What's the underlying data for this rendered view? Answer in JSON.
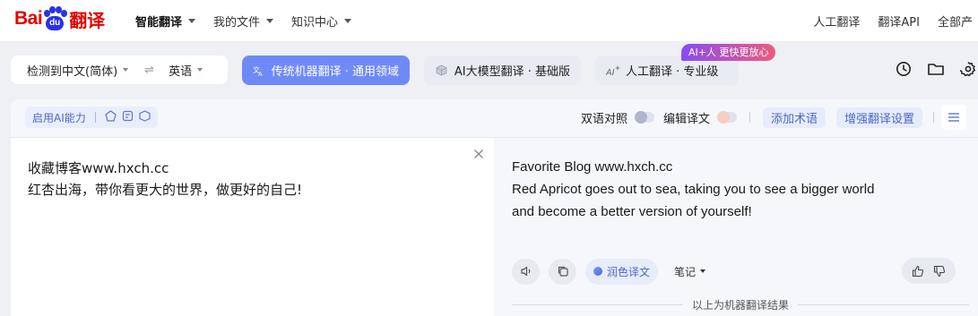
{
  "header": {
    "logo_text_bai": "Bai",
    "logo_text_du": "du",
    "logo_text_fanyi": "翻译",
    "nav": [
      {
        "label": "智能翻译",
        "active": true
      },
      {
        "label": "我的文件",
        "active": false
      },
      {
        "label": "知识中心",
        "active": false
      }
    ],
    "right_links": [
      "人工翻译",
      "翻译API",
      "全部产"
    ]
  },
  "lang": {
    "source": "检测到中文(简体)",
    "swap": "⇌",
    "target": "英语"
  },
  "modes": [
    {
      "label": "传统机器翻译 · 通用领域",
      "active": true,
      "icon": "translate-icon"
    },
    {
      "label": "AI大模型翻译 · 基础版",
      "active": false,
      "icon": "cube-icon"
    },
    {
      "label": "人工翻译 · 专业级",
      "active": false,
      "icon": "ai-sparkle-icon"
    }
  ],
  "promo": "AI+人 更快更放心",
  "toolbar": {
    "ai_label": "启用AI能力",
    "bilingual": "双语对照",
    "edit": "编辑译文",
    "add_term": "添加术语",
    "enhance": "增强翻译设置"
  },
  "source_text": "收藏博客www.hxch.cc\n红杏出海，带你看更大的世界，做更好的自己!",
  "translation": {
    "lines": [
      "Favorite Blog www.hxch.cc",
      "Red Apricot goes out to sea, taking you to see a bigger world",
      "and become a better version of yourself!"
    ],
    "polish": "润色译文",
    "notes": "笔记",
    "machine_note": "以上为机器翻译结果"
  },
  "colors": {
    "brand_red": "#e10602",
    "brand_blue": "#2932e1",
    "accent": "#6f8af7"
  }
}
